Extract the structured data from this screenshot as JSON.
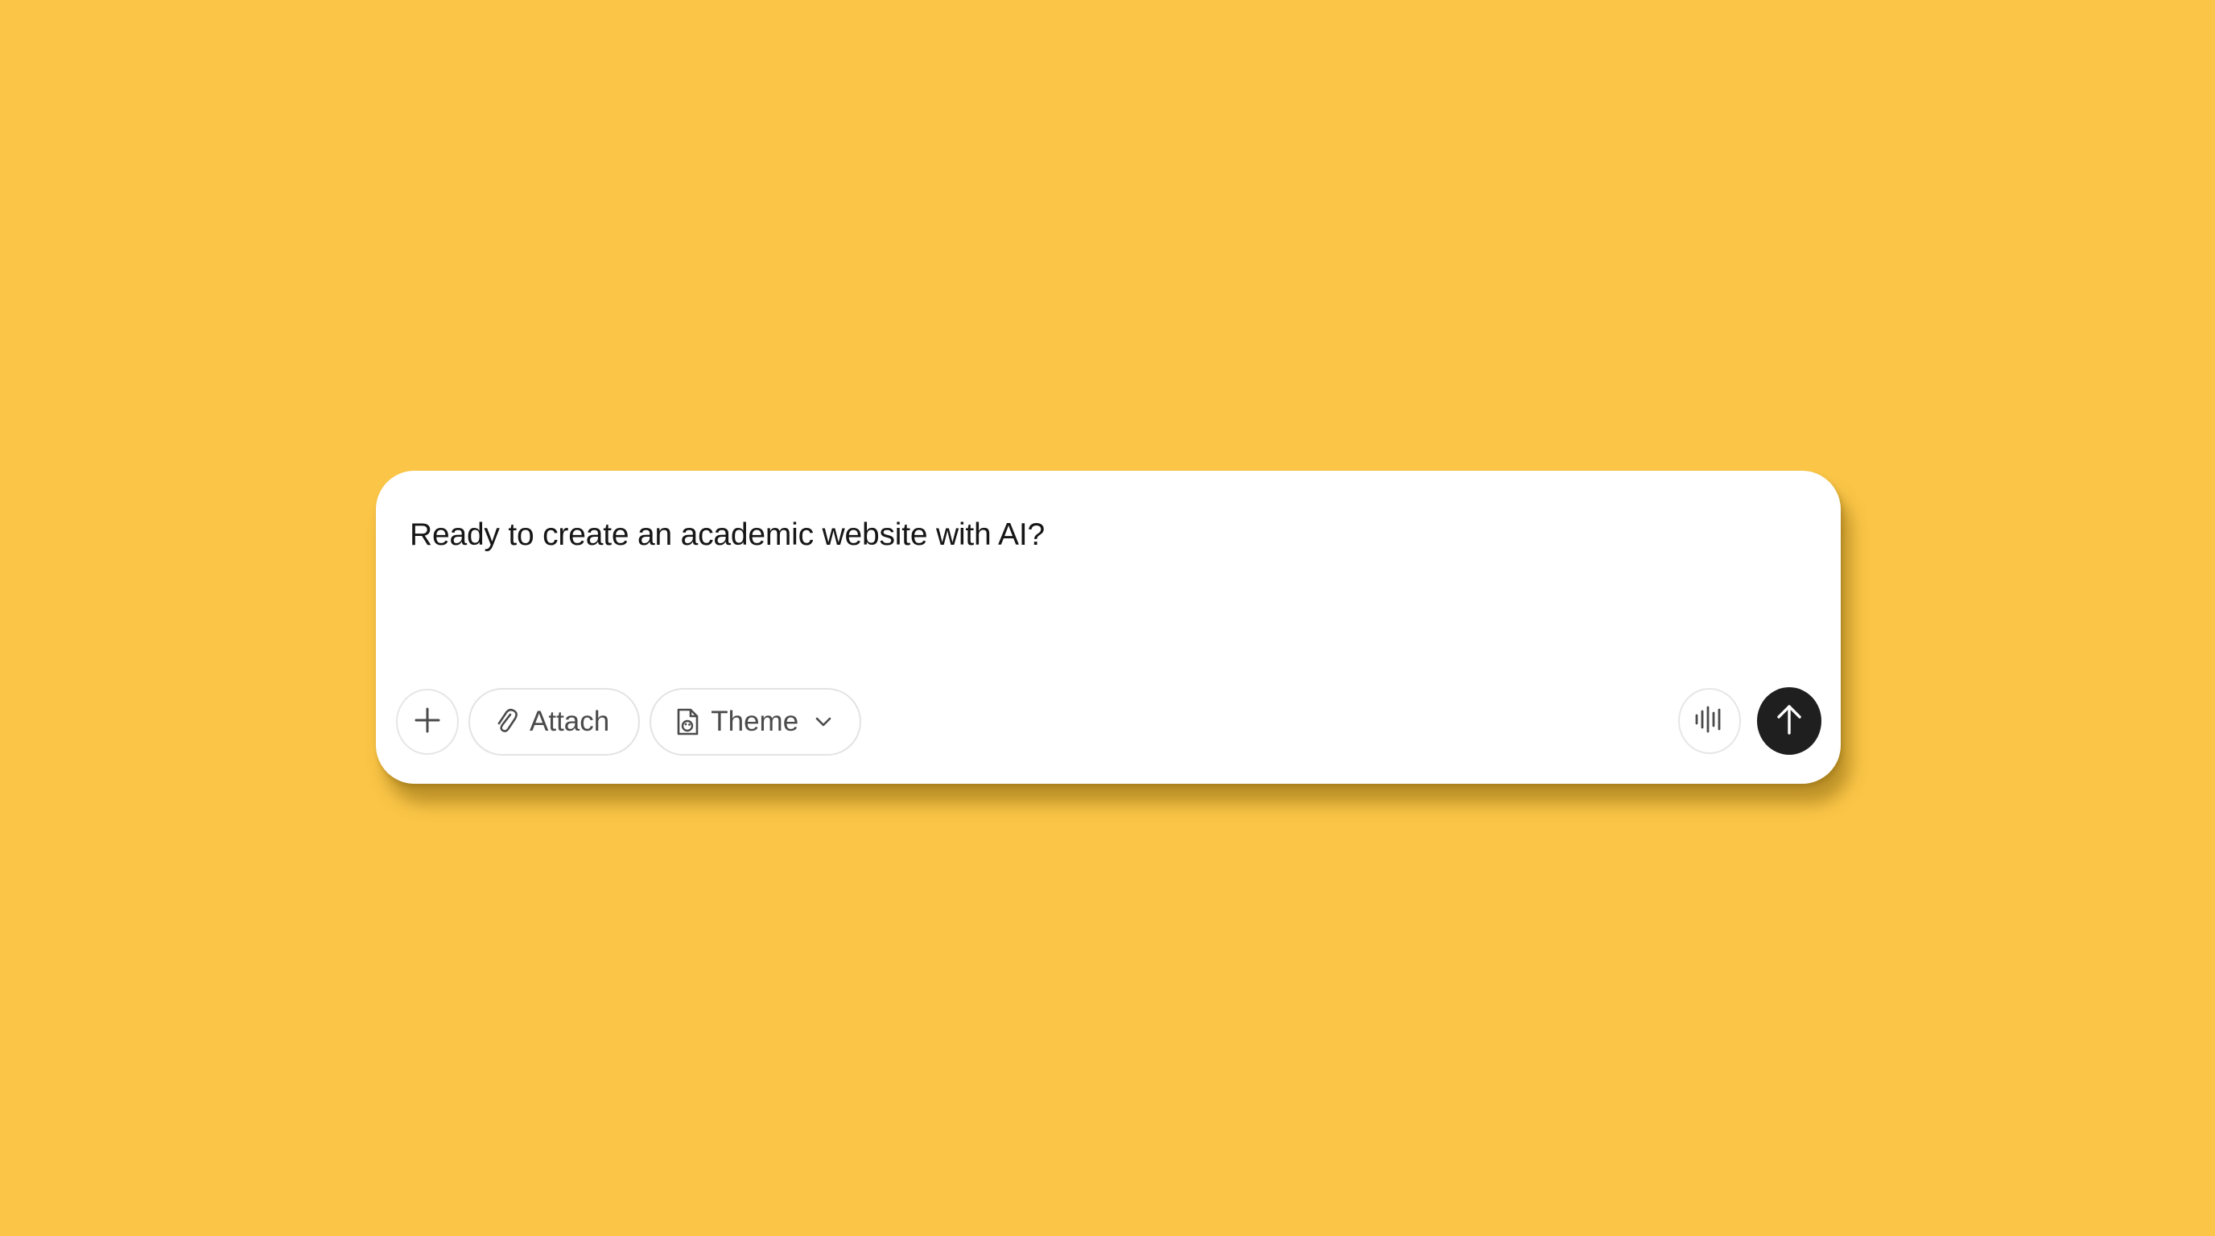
{
  "background_color": "#fbc647",
  "prompt": {
    "placeholder": "Ready to create an academic website with AI?"
  },
  "toolbar": {
    "add": {
      "icon": "plus-icon"
    },
    "attach": {
      "label": "Attach",
      "icon": "paperclip-icon"
    },
    "theme": {
      "label": "Theme",
      "icon": "document-palette-icon",
      "dropdown_icon": "chevron-down-icon"
    },
    "voice": {
      "icon": "voice-waveform-icon"
    },
    "send": {
      "icon": "arrow-up-icon",
      "color": "#1f1f1f"
    }
  }
}
